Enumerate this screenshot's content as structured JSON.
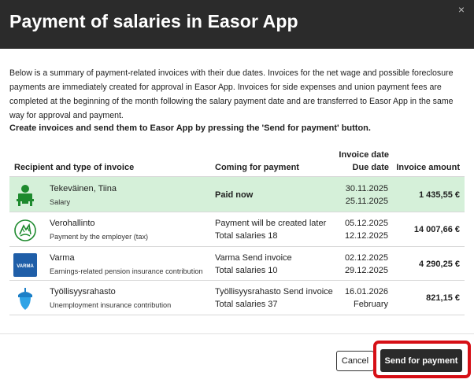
{
  "dialog": {
    "title": "Payment of salaries in Easor App",
    "close_glyph": "×"
  },
  "description": "Below is a summary of payment-related invoices with their due dates. Invoices for the net wage and possible foreclosure payments are immediately created for approval in Easor App. Invoices for side expenses and union payment fees are completed at the beginning of the month following the salary payment date and are transferred to Easor App in the same way for approval and payment.",
  "instruction": "Create invoices and send them to Easor App by pressing the 'Send for payment' button.",
  "table": {
    "headers": {
      "recipient": "Recipient and type of invoice",
      "coming": "Coming for payment",
      "invoice_date": "Invoice date",
      "due_date": "Due date",
      "amount": "Invoice amount"
    },
    "rows": [
      {
        "icon": "person-green-icon",
        "name": "Tekeväinen, Tiina",
        "type": "Salary",
        "payment_line1": "Paid now",
        "payment_line2": "",
        "invoice_date": "30.11.2025",
        "due_date": "25.11.2025",
        "amount": "1 435,55 €"
      },
      {
        "icon": "verohallinto-logo-icon",
        "name": "Verohallinto",
        "type": "Payment by the employer (tax)",
        "payment_line1": "Payment will be created later",
        "payment_line2": "Total salaries 18",
        "invoice_date": "05.12.2025",
        "due_date": "12.12.2025",
        "amount": "14 007,66 €"
      },
      {
        "icon": "varma-logo-icon",
        "logo_text": "VARMA",
        "name": "Varma",
        "type": "Earnings-related pension insurance contribution",
        "payment_line1": "Varma Send invoice",
        "payment_line2": "Total salaries 10",
        "invoice_date": "02.12.2025",
        "due_date": "29.12.2025",
        "amount": "4 290,25 €"
      },
      {
        "icon": "acorn-logo-icon",
        "name": "Työllisyysrahasto",
        "type": "Unemployment insurance contribution",
        "payment_line1": "Työllisyysrahasto Send invoice",
        "payment_line2": "Total salaries 37",
        "invoice_date": "16.01.2026",
        "due_date": "February",
        "amount": "821,15 €"
      }
    ]
  },
  "buttons": {
    "cancel": "Cancel",
    "send": "Send for payment"
  },
  "colors": {
    "header_bg": "#2b2b2b",
    "highlight_row": "#d5f0d9",
    "accent_green": "#1e8a2e",
    "varma_blue": "#1f5ea8",
    "focus_outline": "#d60f16"
  }
}
